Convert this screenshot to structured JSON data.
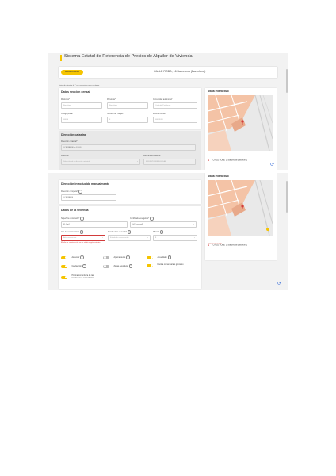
{
  "header": {
    "title": "Sistema Estatal de Referencia de Precios de Alquiler de Vivienda"
  },
  "search": {
    "button_label": "Buscar/Consultar",
    "address": "CALLE ROBB, 16 Barcelona (Barcelona)"
  },
  "note": "Datos de catastro de * son requeridos para continuar",
  "census": {
    "title": "Datos sección censal",
    "fields": [
      {
        "label": "Municipio*",
        "value": "Barcelona"
      },
      {
        "label": "Provincia*",
        "value": "Barcelona"
      },
      {
        "label": "Comunidad autónoma*",
        "value": "Cataluña/Catalunya"
      },
      {
        "label": "Código postal*",
        "value": "08026"
      },
      {
        "label": "Número de Tranjes*",
        "value": "8"
      },
      {
        "label": "Zona territorial*",
        "value": "08019051"
      }
    ]
  },
  "cadastral": {
    "title": "Dirección catastral",
    "street_label": "Dirección catastral*",
    "street_value": "C/ ROBB 16 Es:1 Pl:01",
    "dir_label": "Dirección*",
    "dir_value": "Selección de la dirección catastral",
    "ref_label": "Referencia catastral*",
    "ref_value": "8826907DF3882E0001AA"
  },
  "map": {
    "title": "Mapa interactivo",
    "address": "CALLE ROBB, 16 Barcelona (Barcelona)",
    "zone_link": "Zona tensionada"
  },
  "alert": {
    "text": "Introducir datos manualmente de ubicación eliminando catastral"
  },
  "manual": {
    "title": "Dirección introducida manualmente",
    "field_label": "Dirección completa*",
    "field_value": "C/ ROBB 16"
  },
  "dwelling": {
    "title": "Datos de la vivienda",
    "surface_label": "Superficie construida*",
    "surface_value": "61,1 m2",
    "cert_label": "Certificado energético*",
    "cert_value": "G/Consumo/E",
    "year_label": "Año de construcción*",
    "year_value": "Año constructivo",
    "status_label": "Estado de la vivienda*",
    "status_value": "Estado de conservación",
    "floor_label": "Planta*",
    "floor_value": "1",
    "error_text": "El año de construcción no es válido según catastro"
  },
  "features": [
    {
      "label": "Ascensor",
      "on": true
    },
    {
      "label": "Aparcamiento",
      "on": false
    },
    {
      "label": "Amueblado",
      "on": true
    },
    {
      "label": "Calefacción",
      "on": true
    },
    {
      "label": "Zonas deportivas",
      "on": false
    },
    {
      "label": "Piscina comunitaria o gimnasio",
      "on": true
    },
    {
      "label": "Piscina comunitaria de las instalaciones comunitarias",
      "on": true
    }
  ]
}
